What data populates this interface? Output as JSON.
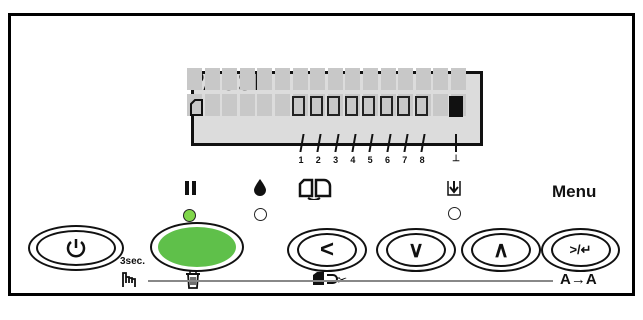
{
  "display": {
    "message": "PAUSE",
    "ink_slots": [
      "1",
      "2",
      "3",
      "4",
      "5",
      "6",
      "7",
      "8"
    ],
    "ink_end_label": "⊥"
  },
  "indicators": {
    "pause_led_color": "#7fd64a",
    "ink_led_color": "#ffffff",
    "paper_led_color": "#ffffff"
  },
  "buttons": {
    "power": {
      "symbol": "⏻"
    },
    "pause": {
      "symbol": "Ⅱ",
      "color": "#5fc04a"
    },
    "left": {
      "symbol": "<"
    },
    "down": {
      "symbol": "∨"
    },
    "up": {
      "symbol": "∧"
    },
    "enter": {
      "symbol": ">/↵"
    }
  },
  "labels": {
    "menu": "Menu",
    "three_sec": "3sec.",
    "cut_label": "✂",
    "font_switch": "A→A"
  },
  "icons": {
    "pause": "pause-icon",
    "ink_drop": "ink-drop-icon",
    "paper_source": "paper-source-icon",
    "paper_feed": "paper-feed-icon",
    "hand": "hand-press-icon",
    "trash": "trash-icon",
    "cutter": "cutter-icon"
  }
}
